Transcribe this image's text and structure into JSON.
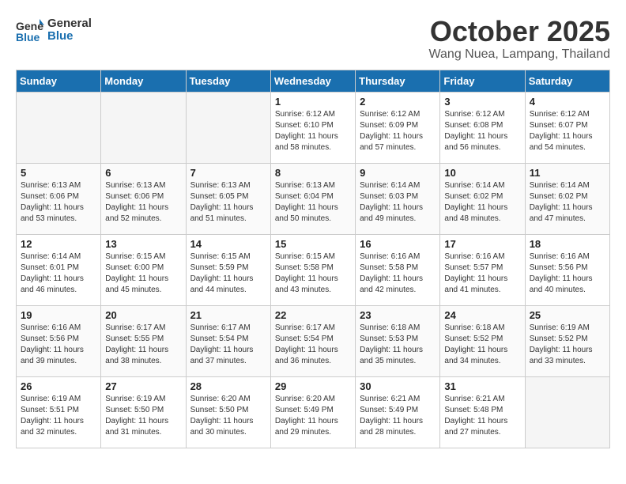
{
  "header": {
    "logo_general": "General",
    "logo_blue": "Blue",
    "month": "October 2025",
    "location": "Wang Nuea, Lampang, Thailand"
  },
  "days_of_week": [
    "Sunday",
    "Monday",
    "Tuesday",
    "Wednesday",
    "Thursday",
    "Friday",
    "Saturday"
  ],
  "weeks": [
    [
      {
        "day": "",
        "empty": true
      },
      {
        "day": "",
        "empty": true
      },
      {
        "day": "",
        "empty": true
      },
      {
        "day": "1",
        "sunrise": "6:12 AM",
        "sunset": "6:10 PM",
        "daylight": "11 hours and 58 minutes."
      },
      {
        "day": "2",
        "sunrise": "6:12 AM",
        "sunset": "6:09 PM",
        "daylight": "11 hours and 57 minutes."
      },
      {
        "day": "3",
        "sunrise": "6:12 AM",
        "sunset": "6:08 PM",
        "daylight": "11 hours and 56 minutes."
      },
      {
        "day": "4",
        "sunrise": "6:12 AM",
        "sunset": "6:07 PM",
        "daylight": "11 hours and 54 minutes."
      }
    ],
    [
      {
        "day": "5",
        "sunrise": "6:13 AM",
        "sunset": "6:06 PM",
        "daylight": "11 hours and 53 minutes."
      },
      {
        "day": "6",
        "sunrise": "6:13 AM",
        "sunset": "6:06 PM",
        "daylight": "11 hours and 52 minutes."
      },
      {
        "day": "7",
        "sunrise": "6:13 AM",
        "sunset": "6:05 PM",
        "daylight": "11 hours and 51 minutes."
      },
      {
        "day": "8",
        "sunrise": "6:13 AM",
        "sunset": "6:04 PM",
        "daylight": "11 hours and 50 minutes."
      },
      {
        "day": "9",
        "sunrise": "6:14 AM",
        "sunset": "6:03 PM",
        "daylight": "11 hours and 49 minutes."
      },
      {
        "day": "10",
        "sunrise": "6:14 AM",
        "sunset": "6:02 PM",
        "daylight": "11 hours and 48 minutes."
      },
      {
        "day": "11",
        "sunrise": "6:14 AM",
        "sunset": "6:02 PM",
        "daylight": "11 hours and 47 minutes."
      }
    ],
    [
      {
        "day": "12",
        "sunrise": "6:14 AM",
        "sunset": "6:01 PM",
        "daylight": "11 hours and 46 minutes."
      },
      {
        "day": "13",
        "sunrise": "6:15 AM",
        "sunset": "6:00 PM",
        "daylight": "11 hours and 45 minutes."
      },
      {
        "day": "14",
        "sunrise": "6:15 AM",
        "sunset": "5:59 PM",
        "daylight": "11 hours and 44 minutes."
      },
      {
        "day": "15",
        "sunrise": "6:15 AM",
        "sunset": "5:58 PM",
        "daylight": "11 hours and 43 minutes."
      },
      {
        "day": "16",
        "sunrise": "6:16 AM",
        "sunset": "5:58 PM",
        "daylight": "11 hours and 42 minutes."
      },
      {
        "day": "17",
        "sunrise": "6:16 AM",
        "sunset": "5:57 PM",
        "daylight": "11 hours and 41 minutes."
      },
      {
        "day": "18",
        "sunrise": "6:16 AM",
        "sunset": "5:56 PM",
        "daylight": "11 hours and 40 minutes."
      }
    ],
    [
      {
        "day": "19",
        "sunrise": "6:16 AM",
        "sunset": "5:56 PM",
        "daylight": "11 hours and 39 minutes."
      },
      {
        "day": "20",
        "sunrise": "6:17 AM",
        "sunset": "5:55 PM",
        "daylight": "11 hours and 38 minutes."
      },
      {
        "day": "21",
        "sunrise": "6:17 AM",
        "sunset": "5:54 PM",
        "daylight": "11 hours and 37 minutes."
      },
      {
        "day": "22",
        "sunrise": "6:17 AM",
        "sunset": "5:54 PM",
        "daylight": "11 hours and 36 minutes."
      },
      {
        "day": "23",
        "sunrise": "6:18 AM",
        "sunset": "5:53 PM",
        "daylight": "11 hours and 35 minutes."
      },
      {
        "day": "24",
        "sunrise": "6:18 AM",
        "sunset": "5:52 PM",
        "daylight": "11 hours and 34 minutes."
      },
      {
        "day": "25",
        "sunrise": "6:19 AM",
        "sunset": "5:52 PM",
        "daylight": "11 hours and 33 minutes."
      }
    ],
    [
      {
        "day": "26",
        "sunrise": "6:19 AM",
        "sunset": "5:51 PM",
        "daylight": "11 hours and 32 minutes."
      },
      {
        "day": "27",
        "sunrise": "6:19 AM",
        "sunset": "5:50 PM",
        "daylight": "11 hours and 31 minutes."
      },
      {
        "day": "28",
        "sunrise": "6:20 AM",
        "sunset": "5:50 PM",
        "daylight": "11 hours and 30 minutes."
      },
      {
        "day": "29",
        "sunrise": "6:20 AM",
        "sunset": "5:49 PM",
        "daylight": "11 hours and 29 minutes."
      },
      {
        "day": "30",
        "sunrise": "6:21 AM",
        "sunset": "5:49 PM",
        "daylight": "11 hours and 28 minutes."
      },
      {
        "day": "31",
        "sunrise": "6:21 AM",
        "sunset": "5:48 PM",
        "daylight": "11 hours and 27 minutes."
      },
      {
        "day": "",
        "empty": true
      }
    ]
  ]
}
